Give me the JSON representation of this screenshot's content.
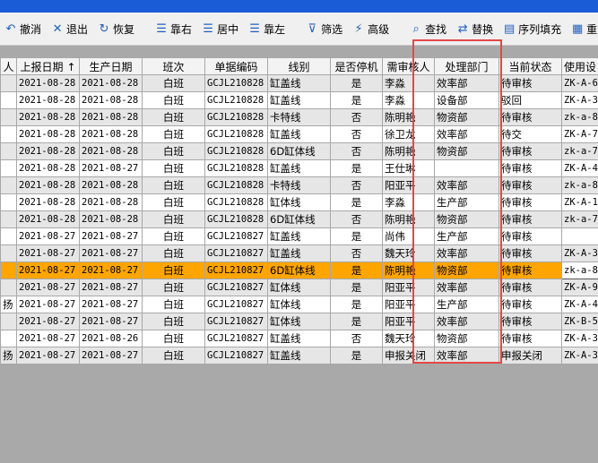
{
  "toolbar": {
    "buttons": [
      {
        "label": "撤消",
        "icon": "undo-icon"
      },
      {
        "label": "退出",
        "icon": "close-icon"
      },
      {
        "label": "恢复",
        "icon": "restore-icon"
      },
      {
        "label": "靠右",
        "icon": "align-right-icon"
      },
      {
        "label": "居中",
        "icon": "align-center-icon"
      },
      {
        "label": "靠左",
        "icon": "align-left-icon"
      },
      {
        "label": "筛选",
        "icon": "filter-icon"
      },
      {
        "label": "高级",
        "icon": "advanced-filter-icon"
      },
      {
        "label": "查找",
        "icon": "binoculars-icon"
      },
      {
        "label": "替换",
        "icon": "replace-icon"
      },
      {
        "label": "序列填充",
        "icon": "sequence-fill-icon"
      },
      {
        "label": "重复填充",
        "icon": "repeat-fill-icon"
      }
    ]
  },
  "grid": {
    "columns": [
      "人",
      "上报日期",
      "生产日期",
      "班次",
      "单据编码",
      "线别",
      "是否停机",
      "需审核人",
      "处理部门",
      "当前状态",
      "使用设"
    ],
    "sort_indicator": "↑",
    "rows": [
      [
        "",
        "2021-08-28",
        "2021-08-28",
        "白班",
        "GCJL210828",
        "缸盖线",
        "是",
        "李淼",
        "效率部",
        "待审核",
        "ZK-A-6"
      ],
      [
        "",
        "2021-08-28",
        "2021-08-28",
        "白班",
        "GCJL210828",
        "缸盖线",
        "是",
        "李淼",
        "设备部",
        "驳回",
        "ZK-A-3"
      ],
      [
        "",
        "2021-08-28",
        "2021-08-28",
        "白班",
        "GCJL210828",
        "卡特线",
        "否",
        "陈明艳",
        "物资部",
        "待审核",
        "zk-a-8"
      ],
      [
        "",
        "2021-08-28",
        "2021-08-28",
        "白班",
        "GCJL210828",
        "缸盖线",
        "否",
        "徐卫龙",
        "效率部",
        "待交",
        "ZK-A-7"
      ],
      [
        "",
        "2021-08-28",
        "2021-08-28",
        "白班",
        "GCJL210828",
        "6D缸体线",
        "否",
        "陈明艳",
        "物资部",
        "待审核",
        "zk-a-7"
      ],
      [
        "",
        "2021-08-28",
        "2021-08-27",
        "白班",
        "GCJL210828",
        "缸盖线",
        "是",
        "王仕琳",
        "",
        "待审核",
        "ZK-A-4"
      ],
      [
        "",
        "2021-08-28",
        "2021-08-28",
        "白班",
        "GCJL210828",
        "卡特线",
        "否",
        "阳亚平",
        "效率部",
        "待审核",
        "zk-a-8"
      ],
      [
        "",
        "2021-08-28",
        "2021-08-28",
        "白班",
        "GCJL210828",
        "缸体线",
        "是",
        "李淼",
        "生产部",
        "待审核",
        "ZK-A-1"
      ],
      [
        "",
        "2021-08-28",
        "2021-08-28",
        "白班",
        "GCJL210828",
        "6D缸体线",
        "否",
        "陈明艳",
        "物资部",
        "待审核",
        "zk-a-7"
      ],
      [
        "",
        "2021-08-27",
        "2021-08-27",
        "白班",
        "GCJL210827",
        "缸盖线",
        "是",
        "尚伟",
        "生产部",
        "待审核",
        ""
      ],
      [
        "",
        "2021-08-27",
        "2021-08-27",
        "白班",
        "GCJL210827",
        "缸盖线",
        "否",
        "魏天玲",
        "效率部",
        "待审核",
        "ZK-A-3"
      ],
      [
        "",
        "2021-08-27",
        "2021-08-27",
        "白班",
        "GCJL210827",
        "6D缸体线",
        "是",
        "陈明艳",
        "物资部",
        "待审核",
        "zk-a-8"
      ],
      [
        "",
        "2021-08-27",
        "2021-08-27",
        "白班",
        "GCJL210827",
        "缸体线",
        "是",
        "阳亚平",
        "效率部",
        "待审核",
        "ZK-A-9"
      ],
      [
        "扬",
        "2021-08-27",
        "2021-08-27",
        "白班",
        "GCJL210827",
        "缸体线",
        "是",
        "阳亚平",
        "生产部",
        "待审核",
        "ZK-A-4"
      ],
      [
        "",
        "2021-08-27",
        "2021-08-27",
        "白班",
        "GCJL210827",
        "缸体线",
        "是",
        "阳亚平",
        "效率部",
        "待审核",
        "ZK-B-5"
      ],
      [
        "",
        "2021-08-27",
        "2021-08-26",
        "白班",
        "GCJL210827",
        "缸盖线",
        "否",
        "魏天玲",
        "物资部",
        "待审核",
        "ZK-A-3"
      ],
      [
        "扬",
        "2021-08-27",
        "2021-08-27",
        "白班",
        "GCJL210827",
        "缸盖线",
        "是",
        "申报关闭",
        "效率部",
        "申报关闭",
        "ZK-A-3"
      ]
    ],
    "selected_row": 11
  },
  "colors": {
    "grid_bg": "#a9a9a9",
    "selected_row": "#ffa500",
    "highlight_box": "#e24848",
    "title_bar": "#1a5bd6"
  }
}
